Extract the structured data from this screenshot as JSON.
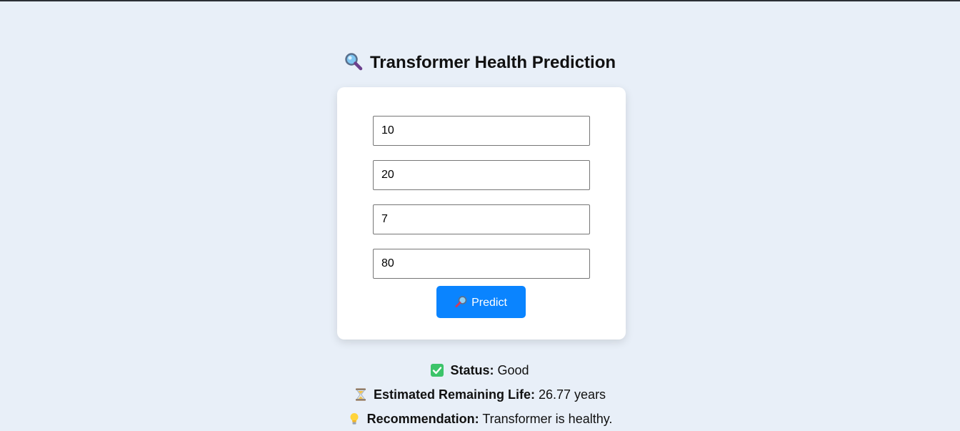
{
  "page": {
    "title": "Transformer Health Prediction",
    "title_icon": "magnifier-icon"
  },
  "form": {
    "fields": [
      {
        "value": "10"
      },
      {
        "value": "20"
      },
      {
        "value": "7"
      },
      {
        "value": "80"
      }
    ],
    "predict_label": "Predict",
    "predict_icon": "magnifier-icon"
  },
  "results": {
    "status": {
      "label": "Status:",
      "value": "Good",
      "icon": "check-mark-icon"
    },
    "remaining_life": {
      "label": "Estimated Remaining Life:",
      "value": "26.77 years",
      "icon": "hourglass-icon"
    },
    "recommendation": {
      "label": "Recommendation:",
      "value": "Transformer is healthy.",
      "icon": "lightbulb-icon"
    }
  },
  "colors": {
    "background": "#e8eff8",
    "card": "#ffffff",
    "button": "#0a84ff",
    "status_ok": "#3cc46a"
  }
}
